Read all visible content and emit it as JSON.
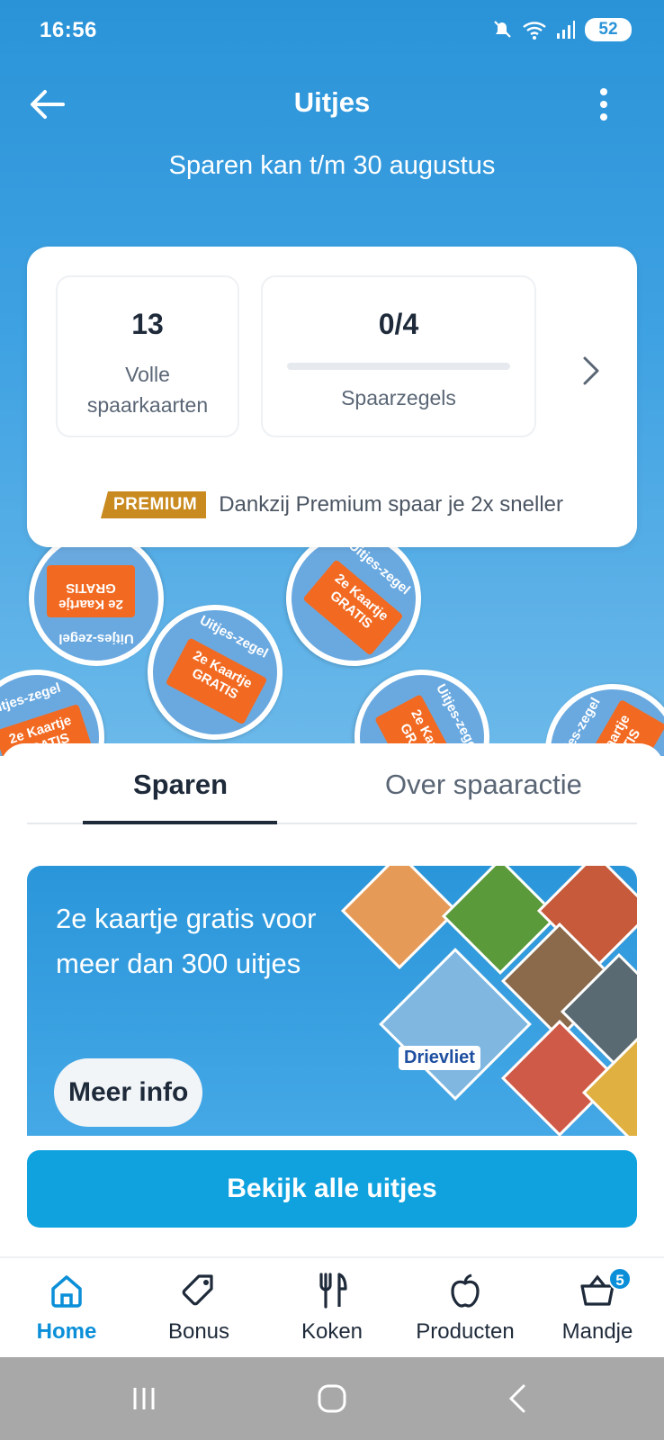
{
  "status_bar": {
    "time": "16:56",
    "battery": "52"
  },
  "header": {
    "title": "Uitjes",
    "subtitle": "Sparen kan t/m 30 augustus"
  },
  "summary": {
    "full_cards_count": "13",
    "full_cards_label_line1": "Volle",
    "full_cards_label_line2": "spaarkaarten",
    "stamps_count": "0/4",
    "stamps_progress": 0,
    "stamps_label": "Spaarzegels",
    "premium_badge": "PREMIUM",
    "premium_text": "Dankzij Premium spaar je 2x sneller"
  },
  "stamps": {
    "ring_text": "Uitjes-zegel",
    "ticket_line1": "2e Kaartje",
    "ticket_line2": "GRATIS"
  },
  "tabs": [
    {
      "label": "Sparen",
      "active": true
    },
    {
      "label": "Over spaaractie",
      "active": false
    }
  ],
  "promo": {
    "headline": "2e kaartje gratis voor meer dan 300 uitjes",
    "button_label": "Meer info",
    "park_label": "Drievliet"
  },
  "cta": {
    "label": "Bekijk alle uitjes"
  },
  "bottom_nav": [
    {
      "label": "Home",
      "icon": "home-icon",
      "active": true
    },
    {
      "label": "Bonus",
      "icon": "tag-icon",
      "active": false
    },
    {
      "label": "Koken",
      "icon": "cutlery-icon",
      "active": false
    },
    {
      "label": "Producten",
      "icon": "apple-icon",
      "active": false
    },
    {
      "label": "Mandje",
      "icon": "basket-icon",
      "active": false,
      "badge": "5"
    }
  ],
  "colors": {
    "brand_blue": "#00a0e2",
    "hero_blue": "#2a93d8",
    "premium_gold": "#c98a1f",
    "stamp_orange": "#f26a21"
  }
}
